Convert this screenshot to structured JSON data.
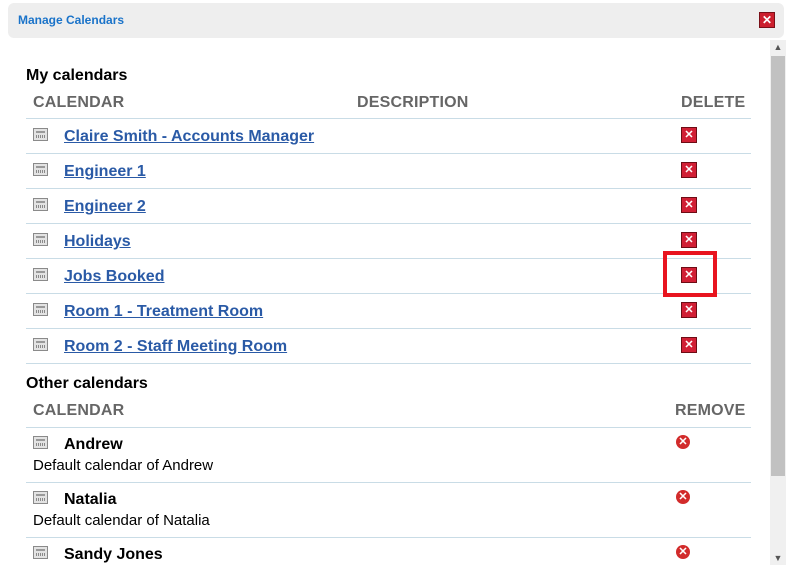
{
  "window": {
    "title": "Manage Calendars",
    "close_glyph": "✕"
  },
  "my_calendars": {
    "heading": "My calendars",
    "col_calendar": "CALENDAR",
    "col_description": "DESCRIPTION",
    "col_delete": "DELETE",
    "rows": [
      {
        "name": "Claire Smith - Accounts Manager"
      },
      {
        "name": "Engineer 1"
      },
      {
        "name": "Engineer 2"
      },
      {
        "name": "Holidays"
      },
      {
        "name": "Jobs Booked"
      },
      {
        "name": "Room 1 - Treatment Room"
      },
      {
        "name": "Room 2 - Staff Meeting Room"
      }
    ],
    "delete_glyph": "✕"
  },
  "other_calendars": {
    "heading": "Other calendars",
    "col_calendar": "CALENDAR",
    "col_remove": "REMOVE",
    "rows": [
      {
        "name": "Andrew",
        "description": "Default calendar of Andrew"
      },
      {
        "name": "Natalia",
        "description": "Default calendar of Natalia"
      },
      {
        "name": "Sandy Jones"
      }
    ],
    "remove_glyph": "✕"
  },
  "icons": {
    "calendar": "calendar-icon",
    "delete": "delete-x-icon",
    "remove": "remove-circle-icon",
    "close": "close-icon"
  },
  "colors": {
    "link": "#2a5aa6",
    "title": "#1a73c9",
    "delete_red": "#d11f35",
    "highlight": "#e8141f"
  }
}
